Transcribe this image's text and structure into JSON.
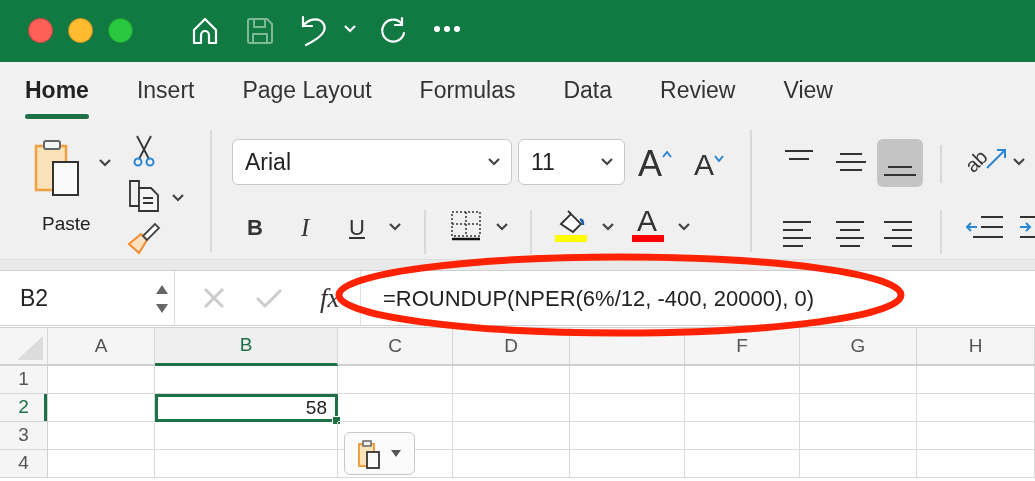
{
  "ribbon_tabs": [
    {
      "label": "Home",
      "selected": true
    },
    {
      "label": "Insert",
      "selected": false
    },
    {
      "label": "Page Layout",
      "selected": false
    },
    {
      "label": "Formulas",
      "selected": false
    },
    {
      "label": "Data",
      "selected": false
    },
    {
      "label": "Review",
      "selected": false
    },
    {
      "label": "View",
      "selected": false
    }
  ],
  "clipboard": {
    "paste_label": "Paste"
  },
  "font": {
    "name": "Arial",
    "size": "11"
  },
  "font_size_buttons": [
    {
      "label": "A",
      "kind": "grow"
    },
    {
      "label": "A",
      "kind": "shrink"
    }
  ],
  "format_buttons": [
    {
      "label": "B",
      "kind": "bold"
    },
    {
      "label": "I",
      "kind": "italic"
    },
    {
      "label": "U",
      "kind": "underline"
    }
  ],
  "fill_color": {
    "color": "#ffff00"
  },
  "font_color": {
    "label": "A",
    "color": "#ff0000"
  },
  "vertical_align": [
    {
      "kind": "top",
      "selected": false
    },
    {
      "kind": "middle",
      "selected": false
    },
    {
      "kind": "bottom",
      "selected": true
    }
  ],
  "orientation": {
    "label": "ab"
  },
  "horizontal_align": [
    {
      "kind": "left",
      "selected": false
    },
    {
      "kind": "center",
      "selected": false
    },
    {
      "kind": "right",
      "selected": false
    }
  ],
  "formula_bar": {
    "name_box": "B2",
    "function_label": "fx",
    "formula": "=ROUNDUP(NPER(6%/12, -400, 20000), 0)"
  },
  "columns": [
    {
      "label": "A",
      "selected": false
    },
    {
      "label": "B",
      "selected": true
    },
    {
      "label": "C",
      "selected": false
    },
    {
      "label": "D",
      "selected": false
    },
    {
      "selected": false
    },
    {
      "label": "F",
      "selected": false
    },
    {
      "label": "G",
      "selected": false
    },
    {
      "label": "H",
      "selected": false
    }
  ],
  "rows": [
    {
      "label": "1",
      "selected": false
    },
    {
      "label": "2",
      "selected": true
    },
    {
      "label": "3",
      "selected": false
    },
    {
      "label": "4",
      "selected": false
    }
  ],
  "active_cell": {
    "value": "58"
  }
}
